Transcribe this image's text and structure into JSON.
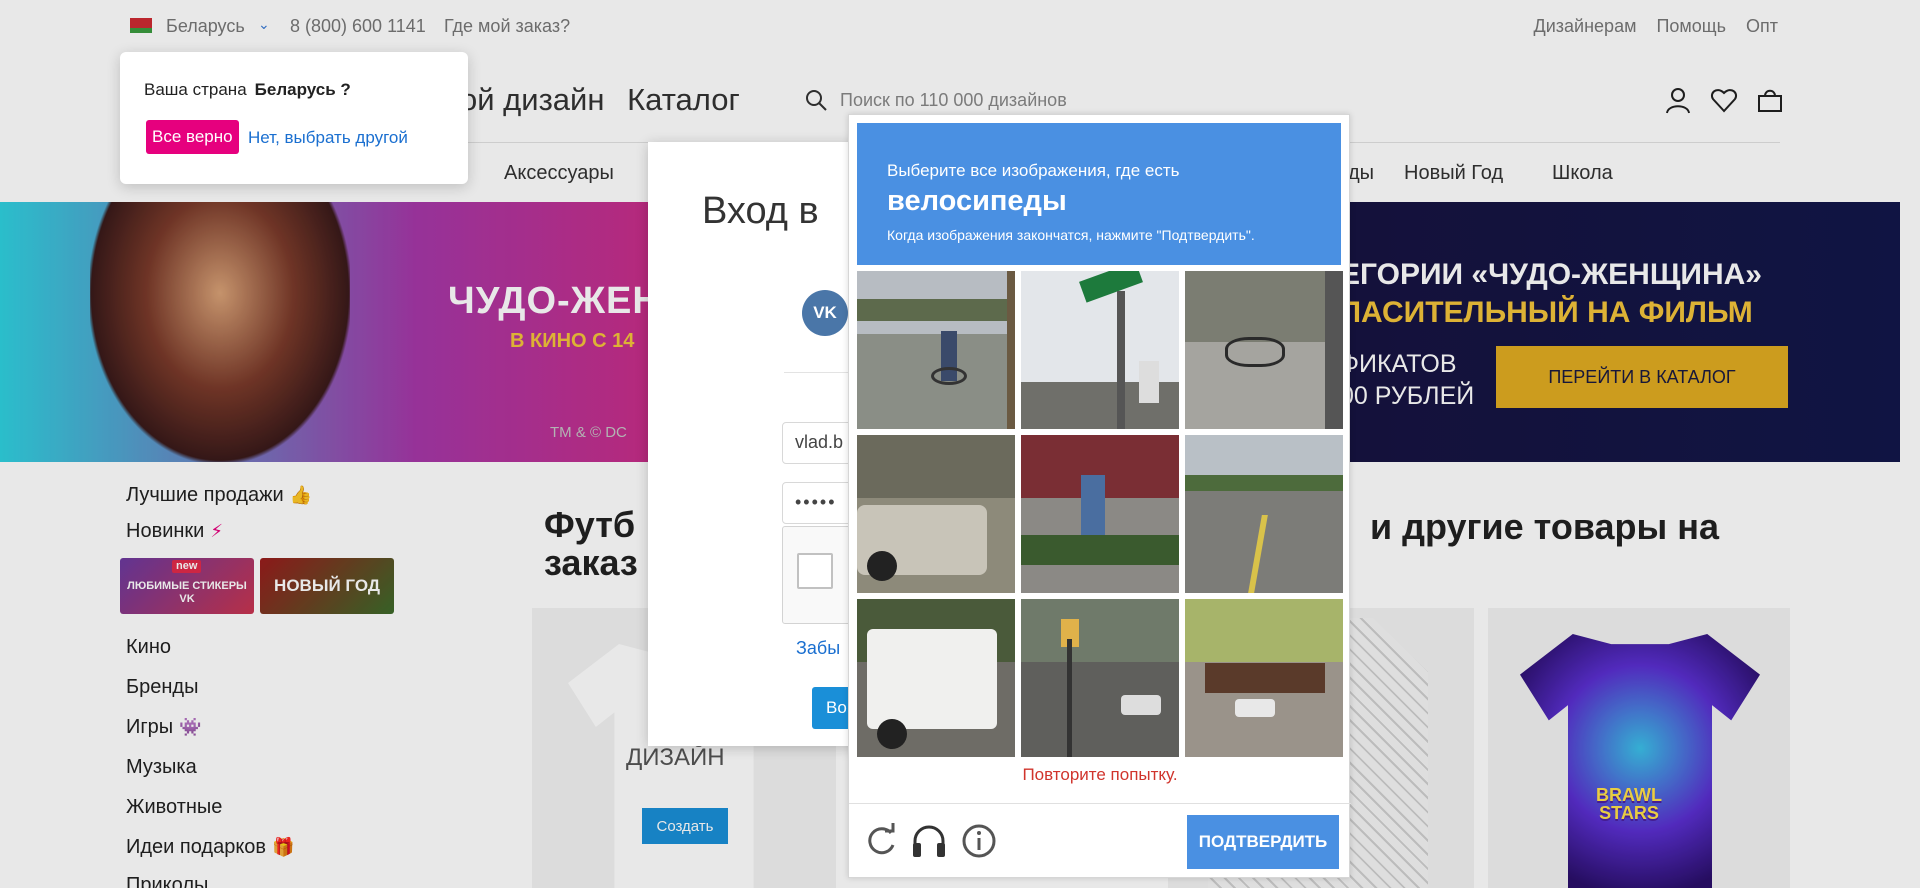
{
  "topbar": {
    "country": "Беларусь",
    "phone": "8 (800) 600 1141",
    "order_link": "Где мой заказ?",
    "right_links": [
      "Дизайнерам",
      "Помощь",
      "Опт"
    ]
  },
  "header": {
    "logo_fragment": "ой дизайн",
    "catalog": "Каталог",
    "search_placeholder": "Поиск по 110 000 дизайнов"
  },
  "nav": {
    "items": [
      "Аксессуары",
      "ды",
      "Новый Год",
      "Школа"
    ]
  },
  "banner": {
    "title": "ЧУДО-ЖЕНЩ",
    "subtitle": "В КИНО С 14",
    "tm": "TM & © DC",
    "right_line1": "ЕГОРИИ «ЧУДО-ЖЕНЩИНА»",
    "right_line2": "ЛАСИТЕЛЬНЫЙ НА ФИЛЬМ",
    "right_line3": "ФИКАТОВ",
    "right_line4": "00 РУБЛЕЙ",
    "button": "ПЕРЕЙТИ В КАТАЛОГ"
  },
  "sidebar": {
    "items": [
      {
        "label": "Лучшие продажи",
        "emoji": "👍"
      },
      {
        "label": "Новинки",
        "emoji": "⚡"
      },
      {
        "label": "Кино",
        "emoji": ""
      },
      {
        "label": "Бренды",
        "emoji": ""
      },
      {
        "label": "Игры",
        "emoji": "👾"
      },
      {
        "label": "Музыка",
        "emoji": ""
      },
      {
        "label": "Животные",
        "emoji": ""
      },
      {
        "label": "Идеи подарков",
        "emoji": "🎁"
      },
      {
        "label": "Приколы",
        "emoji": ""
      }
    ],
    "tile1_new": "new",
    "tile1_text": "ЛЮБИМЫЕ СТИКЕРЫ VK",
    "tile2_text": "НОВЫЙ ГОД"
  },
  "main": {
    "heading_line1": "Футб",
    "heading_line2": "заказ",
    "heading_right": "и другие товары на",
    "card1_label": "ДИЗАЙН",
    "card1_button": "Создать",
    "card4_logo_line1": "BRAWL",
    "card4_logo_line2": "STARS"
  },
  "country_popover": {
    "question": "Ваша страна",
    "country": "Беларусь ?",
    "confirm": "Все верно",
    "other": "Нет, выбрать другой"
  },
  "login": {
    "title": "Вход в",
    "vk": "VK",
    "email_value": "vlad.b",
    "password_mask": "•••••",
    "forgot": "Забы",
    "submit": "Во"
  },
  "captcha": {
    "instruction": "Выберите все изображения, где есть",
    "target": "велосипеды",
    "hint": "Когда изображения закончатся, нажмите \"Подтвердить\".",
    "error": "Повторите попытку.",
    "verify": "ПОДТВЕРДИТЬ",
    "colors": {
      "header": "#4a90e2",
      "error": "#d0342c"
    }
  }
}
